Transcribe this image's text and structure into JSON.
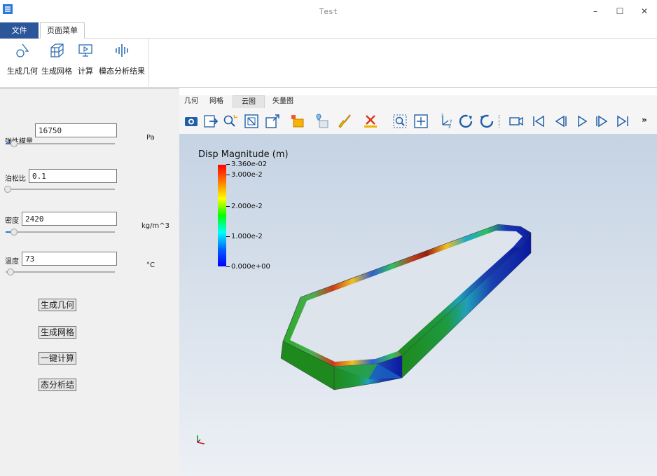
{
  "window": {
    "title": "Test"
  },
  "ribbon": {
    "tabs": [
      "文件",
      "页面菜单"
    ],
    "buttons": [
      "生成几何",
      "生成网格",
      "计算",
      "模态分析结果"
    ]
  },
  "params": {
    "elastic_modulus": {
      "label": "弹性模量",
      "value": "16750",
      "unit": "Pa"
    },
    "poisson": {
      "label": "泊松比",
      "value": "0.1"
    },
    "density": {
      "label": "密度",
      "value": "2420",
      "unit": "kg/m^3"
    },
    "temperature": {
      "label": "温度",
      "value": "73",
      "unit": "°C"
    }
  },
  "actions": [
    "生成几何",
    "生成网格",
    "一键计算",
    "态分析结"
  ],
  "view": {
    "tabs": [
      "几何",
      "网格",
      "云图",
      "矢量图"
    ],
    "active_tab": "云图",
    "legend": {
      "title": "Disp Magnitude (m)",
      "ticks": [
        "3.360e-02",
        "3.000e-2",
        "2.000e-2",
        "1.000e-2",
        "0.000e+00"
      ],
      "min": 0.0,
      "max": 0.0336
    }
  }
}
